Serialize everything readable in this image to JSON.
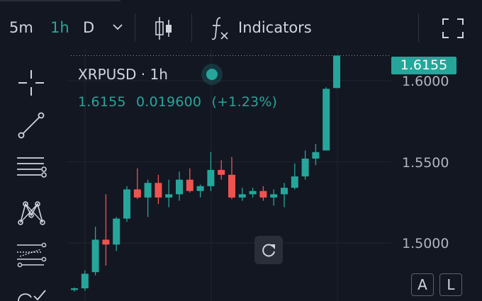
{
  "toolbar": {
    "timeframes": [
      "5m",
      "1h",
      "D"
    ],
    "active_timeframe": "1h",
    "timeframe_dropdown_icon": "chevron-down-icon",
    "chart_type_icon": "candlestick-icon",
    "indicators_icon": "fx-icon",
    "indicators_label": "Indicators",
    "fullscreen_icon": "fullscreen-icon"
  },
  "sidebar": {
    "tools": [
      "crosshair-icon",
      "trend-line-icon",
      "horizontal-lines-icon",
      "pattern-icon",
      "fib-levels-icon",
      "more-tools-icon"
    ]
  },
  "legend": {
    "symbol": "XRPUSD",
    "separator": "·",
    "interval": "1h",
    "close": "1.6155",
    "change": "0.019600",
    "change_pct": "(+1.23%)"
  },
  "price_axis": {
    "labels": [
      "1.6000",
      "1.5500",
      "1.5000"
    ],
    "current_price": "1.6155"
  },
  "buttons": {
    "reset_icon": "reset-icon",
    "auto_scale": "A",
    "log_scale": "L"
  },
  "colors": {
    "background": "#131722",
    "up": "#26a69a",
    "down": "#ef5350",
    "grid": "#1f2430"
  },
  "chart_data": {
    "type": "candlestick",
    "symbol": "XRPUSD",
    "interval": "1h",
    "ylim": [
      1.47,
      1.63
    ],
    "y_ticks": [
      1.5,
      1.55,
      1.6
    ],
    "current_price": 1.6155,
    "candles": [
      {
        "o": 1.471,
        "h": 1.4725,
        "l": 1.47,
        "c": 1.472
      },
      {
        "o": 1.472,
        "h": 1.483,
        "l": 1.4705,
        "c": 1.481
      },
      {
        "o": 1.482,
        "h": 1.51,
        "l": 1.48,
        "c": 1.502
      },
      {
        "o": 1.502,
        "h": 1.53,
        "l": 1.486,
        "c": 1.499
      },
      {
        "o": 1.499,
        "h": 1.516,
        "l": 1.495,
        "c": 1.515
      },
      {
        "o": 1.515,
        "h": 1.535,
        "l": 1.513,
        "c": 1.533
      },
      {
        "o": 1.533,
        "h": 1.546,
        "l": 1.527,
        "c": 1.528
      },
      {
        "o": 1.528,
        "h": 1.539,
        "l": 1.516,
        "c": 1.537
      },
      {
        "o": 1.537,
        "h": 1.542,
        "l": 1.524,
        "c": 1.528
      },
      {
        "o": 1.528,
        "h": 1.539,
        "l": 1.522,
        "c": 1.53
      },
      {
        "o": 1.53,
        "h": 1.544,
        "l": 1.526,
        "c": 1.539
      },
      {
        "o": 1.539,
        "h": 1.546,
        "l": 1.531,
        "c": 1.532
      },
      {
        "o": 1.532,
        "h": 1.536,
        "l": 1.528,
        "c": 1.535
      },
      {
        "o": 1.535,
        "h": 1.556,
        "l": 1.532,
        "c": 1.545
      },
      {
        "o": 1.545,
        "h": 1.551,
        "l": 1.539,
        "c": 1.542
      },
      {
        "o": 1.542,
        "h": 1.553,
        "l": 1.527,
        "c": 1.528
      },
      {
        "o": 1.528,
        "h": 1.534,
        "l": 1.526,
        "c": 1.53
      },
      {
        "o": 1.53,
        "h": 1.534,
        "l": 1.528,
        "c": 1.532
      },
      {
        "o": 1.532,
        "h": 1.535,
        "l": 1.526,
        "c": 1.528
      },
      {
        "o": 1.528,
        "h": 1.533,
        "l": 1.523,
        "c": 1.53
      },
      {
        "o": 1.53,
        "h": 1.537,
        "l": 1.522,
        "c": 1.534
      },
      {
        "o": 1.534,
        "h": 1.549,
        "l": 1.533,
        "c": 1.541
      },
      {
        "o": 1.541,
        "h": 1.557,
        "l": 1.539,
        "c": 1.552
      },
      {
        "o": 1.552,
        "h": 1.561,
        "l": 1.548,
        "c": 1.556
      },
      {
        "o": 1.557,
        "h": 1.596,
        "l": 1.557,
        "c": 1.595
      },
      {
        "o": 1.5955,
        "h": 1.6155,
        "l": 1.5955,
        "c": 1.6155
      }
    ]
  }
}
